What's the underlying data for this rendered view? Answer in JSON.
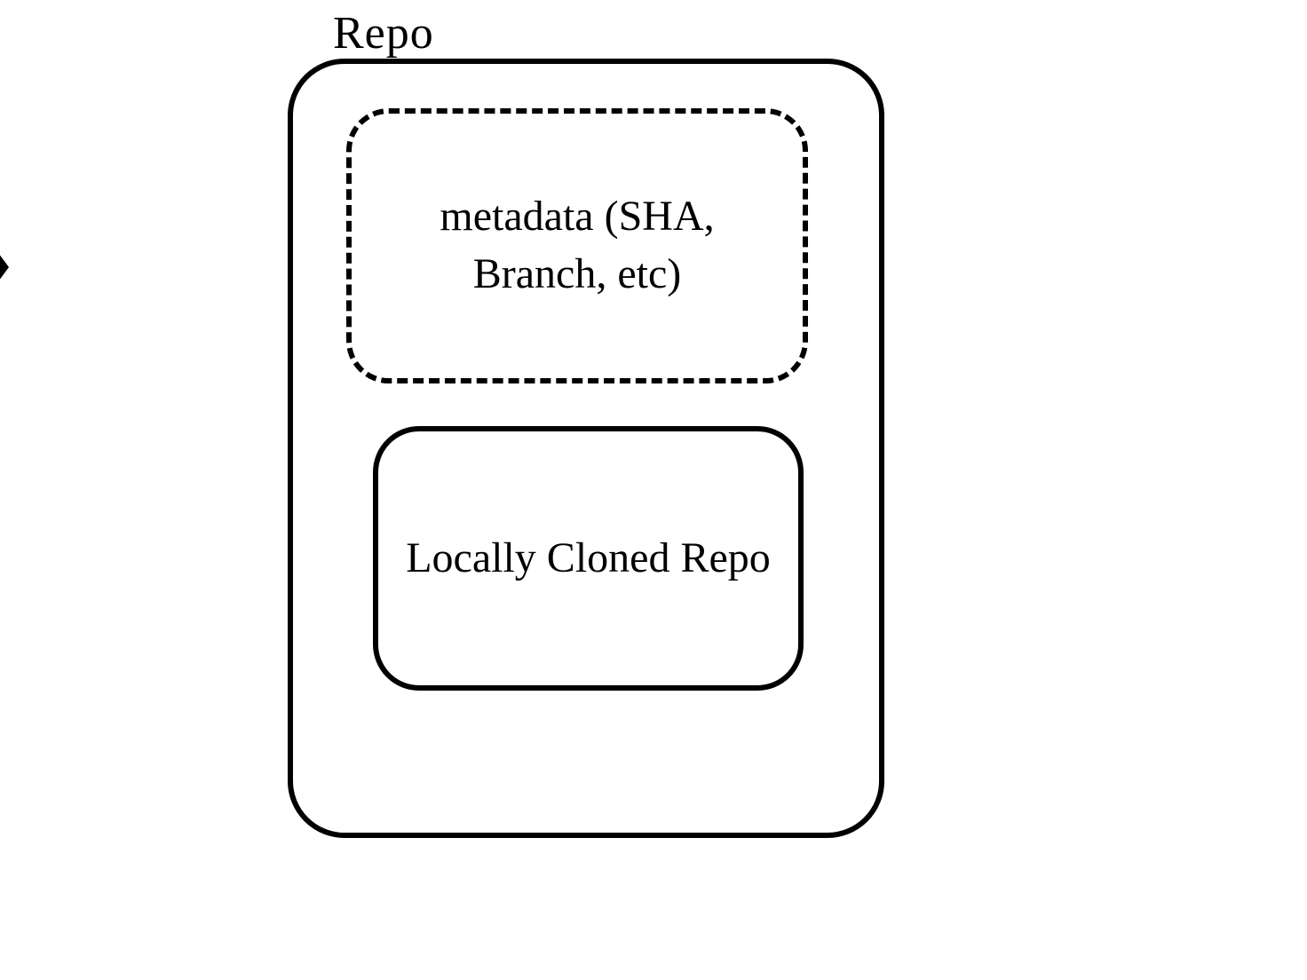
{
  "diagram": {
    "outer": {
      "label": "Repo"
    },
    "boxes": {
      "metadata": {
        "text": "metadata (SHA, Branch, etc)"
      },
      "cloned": {
        "text": "Locally Cloned Repo"
      }
    }
  }
}
